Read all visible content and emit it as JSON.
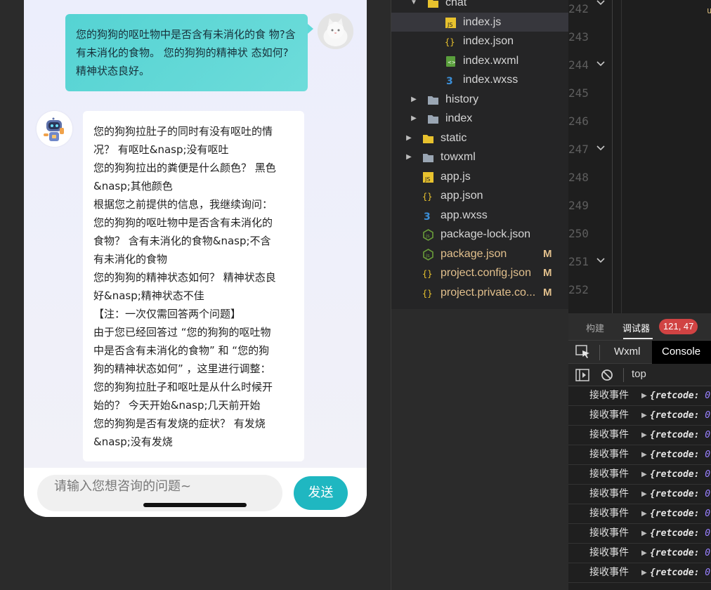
{
  "simulator": {
    "user_message": {
      "lines": [
        "您的狗狗的呕吐物中是否含有未消化的食",
        "物?含有未消化的食物。 您的狗狗的精神状",
        "态如何? 精神状态良好。"
      ]
    },
    "bot_message": {
      "lines": [
        "您的狗狗拉肚子的同时有没有呕吐的情",
        "况？ 有呕吐&nasp;没有呕吐",
        "您的狗狗拉出的粪便是什么颜色？ 黑色",
        "&nasp;其他颜色",
        "根据您之前提供的信息，我继续询问：",
        "您的狗狗的呕吐物中是否含有未消化的",
        "食物？ 含有未消化的食物&nasp;不含",
        "有未消化的食物",
        "您的狗狗的精神状态如何？ 精神状态良",
        "好&nasp;精神状态不佳",
        "【注：一次仅需回答两个问题】",
        "由于您已经回答过 “您的狗狗的呕吐物",
        "中是否含有未消化的食物” 和 “您的狗",
        "狗的精神状态如何” ，这里进行调整：",
        "您的狗狗拉肚子和呕吐是从什么时候开",
        "始的？ 今天开始&nasp;几天前开始",
        "您的狗狗是否有发烧的症状？ 有发烧",
        "&nasp;没有发烧"
      ]
    },
    "input_placeholder": "请输入您想咨询的问题~",
    "send_label": "发送"
  },
  "file_tree": {
    "items": [
      {
        "label": "chat",
        "icon": "folder-open-icon",
        "kind": "folder-open",
        "modified": false,
        "selected": false
      },
      {
        "label": "index.js",
        "icon": "js-file-icon",
        "kind": "js",
        "modified": false,
        "selected": true
      },
      {
        "label": "index.json",
        "icon": "json-file-icon",
        "kind": "json",
        "modified": false,
        "selected": false
      },
      {
        "label": "index.wxml",
        "icon": "wxml-file-icon",
        "kind": "wxml",
        "modified": false,
        "selected": false
      },
      {
        "label": "index.wxss",
        "icon": "css-file-icon",
        "kind": "css",
        "modified": false,
        "selected": false
      },
      {
        "label": "history",
        "icon": "folder-icon",
        "kind": "folder",
        "modified": false,
        "selected": false
      },
      {
        "label": "index",
        "icon": "folder-icon",
        "kind": "folder",
        "modified": false,
        "selected": false
      },
      {
        "label": "static",
        "icon": "folder-icon",
        "kind": "folder-special",
        "modified": false,
        "selected": false
      },
      {
        "label": "towxml",
        "icon": "folder-icon",
        "kind": "folder",
        "modified": false,
        "selected": false
      },
      {
        "label": "app.js",
        "icon": "js-file-icon",
        "kind": "js",
        "modified": false,
        "selected": false
      },
      {
        "label": "app.json",
        "icon": "json-file-icon",
        "kind": "json",
        "modified": false,
        "selected": false
      },
      {
        "label": "app.wxss",
        "icon": "css-file-icon",
        "kind": "css",
        "modified": false,
        "selected": false
      },
      {
        "label": "package-lock.json",
        "icon": "node-file-icon",
        "kind": "node",
        "modified": false,
        "selected": false
      },
      {
        "label": "package.json",
        "icon": "node-file-icon",
        "kind": "node",
        "modified": true,
        "selected": false
      },
      {
        "label": "project.config.json",
        "icon": "json-file-icon",
        "kind": "json",
        "modified": true,
        "selected": false
      },
      {
        "label": "project.private.co...",
        "icon": "json-file-icon",
        "kind": "json",
        "modified": true,
        "selected": false
      }
    ],
    "modified_flag": "M"
  },
  "editor": {
    "line_numbers": [
      "242",
      "243",
      "244",
      "245",
      "246",
      "247",
      "248",
      "249",
      "250",
      "251",
      "252"
    ]
  },
  "debugger": {
    "tabs": [
      "构建",
      "调试器"
    ],
    "active_tab": "调试器",
    "badge": "121, 47",
    "subtabs": [
      "Wxml",
      "Console"
    ],
    "active_subtab": "Console",
    "context": "top",
    "console_rows": [
      {
        "label": "接收事件",
        "value_prefix": "{retcode: ",
        "value_num": "0"
      },
      {
        "label": "接收事件",
        "value_prefix": "{retcode: ",
        "value_num": "0"
      },
      {
        "label": "接收事件",
        "value_prefix": "{retcode: ",
        "value_num": "0"
      },
      {
        "label": "接收事件",
        "value_prefix": "{retcode: ",
        "value_num": "0"
      },
      {
        "label": "接收事件",
        "value_prefix": "{retcode: ",
        "value_num": "0"
      },
      {
        "label": "接收事件",
        "value_prefix": "{retcode: ",
        "value_num": "0"
      },
      {
        "label": "接收事件",
        "value_prefix": "{retcode: ",
        "value_num": "0"
      },
      {
        "label": "接收事件",
        "value_prefix": "{retcode: ",
        "value_num": "0"
      },
      {
        "label": "接收事件",
        "value_prefix": "{retcode: ",
        "value_num": "0"
      },
      {
        "label": "接收事件",
        "value_prefix": "{retcode: ",
        "value_num": "0"
      }
    ]
  },
  "colors": {
    "user_bubble": "#5fd9d9",
    "send_button": "#1fb7c1",
    "badge": "#d14343",
    "modified": "#e2c08d"
  }
}
